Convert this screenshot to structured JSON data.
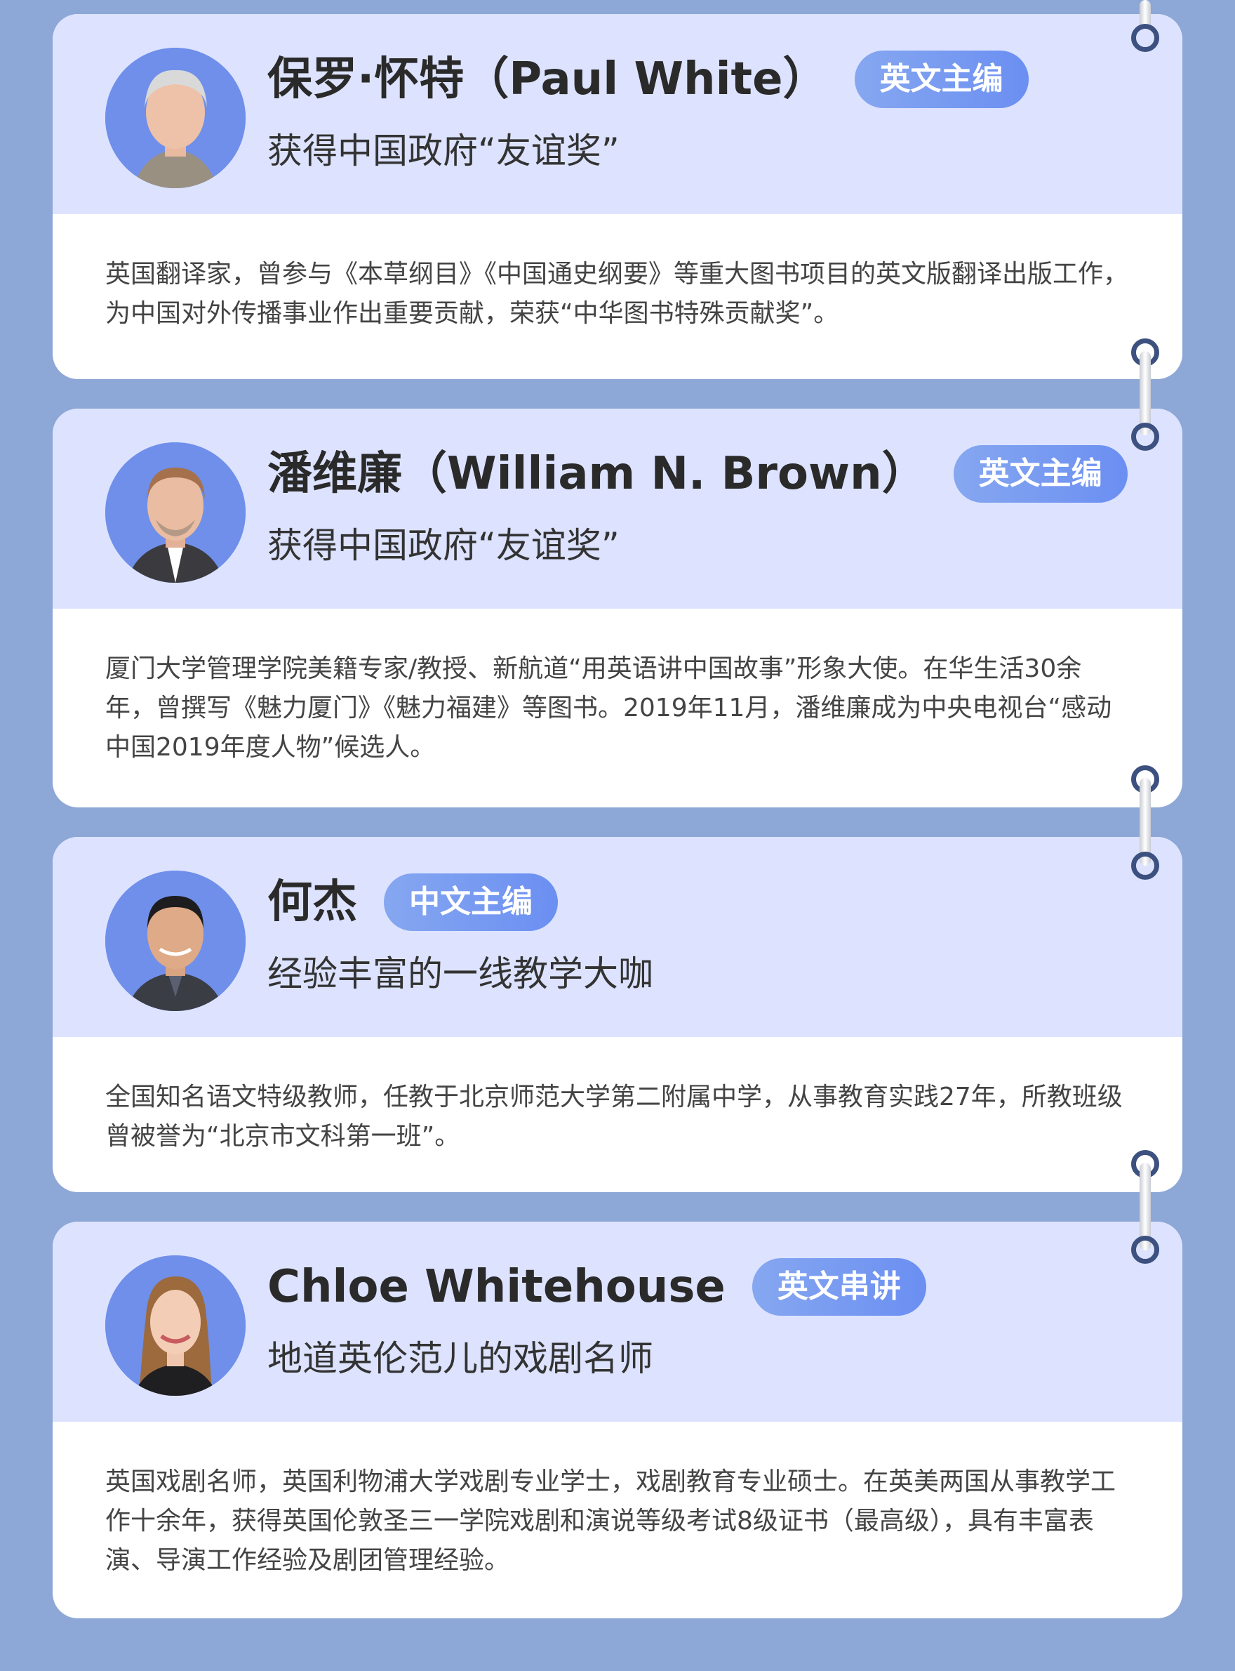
{
  "cards": [
    {
      "name": "保罗·怀特（Paul White）",
      "badge": "英文主编",
      "subtitle": "获得中国政府“友谊奖”",
      "description": "英国翻译家，曾参与《本草纲目》《中国通史纲要》等重大图书项目的英文版翻译出版工作，为中国对外传播事业作出重要贡献，荣获“中华图书特殊贡献奖”。"
    },
    {
      "name": "潘维廉（William N. Brown）",
      "badge": "英文主编",
      "subtitle": "获得中国政府“友谊奖”",
      "description": "厦门大学管理学院美籍专家/教授、新航道“用英语讲中国故事”形象大使。在华生活30余年，曾撰写《魅力厦门》《魅力福建》等图书。2019年11月，潘维廉成为中央电视台“感动中国2019年度人物”候选人。"
    },
    {
      "name": "何杰",
      "badge": "中文主编",
      "subtitle": "经验丰富的一线教学大咖",
      "description": "全国知名语文特级教师，任教于北京师范大学第二附属中学，从事教育实践27年，所教班级曾被誉为“北京市文科第一班”。"
    },
    {
      "name": "Chloe Whitehouse",
      "badge": "英文串讲",
      "subtitle": "地道英伦范儿的戏剧名师",
      "description": "英国戏剧名师，英国利物浦大学戏剧专业学士，戏剧教育专业硕士。在英美两国从事教学工作十余年，获得英国伦敦圣三一学院戏剧和演说等级考试8级证书（最高级），具有丰富表演、导演工作经验及剧团管理经验。"
    }
  ],
  "colors": {
    "background": "#8da7d6",
    "card_header": "#dde3ff",
    "badge": "#7a9bf0",
    "avatar_bg": "#6f8fea"
  }
}
